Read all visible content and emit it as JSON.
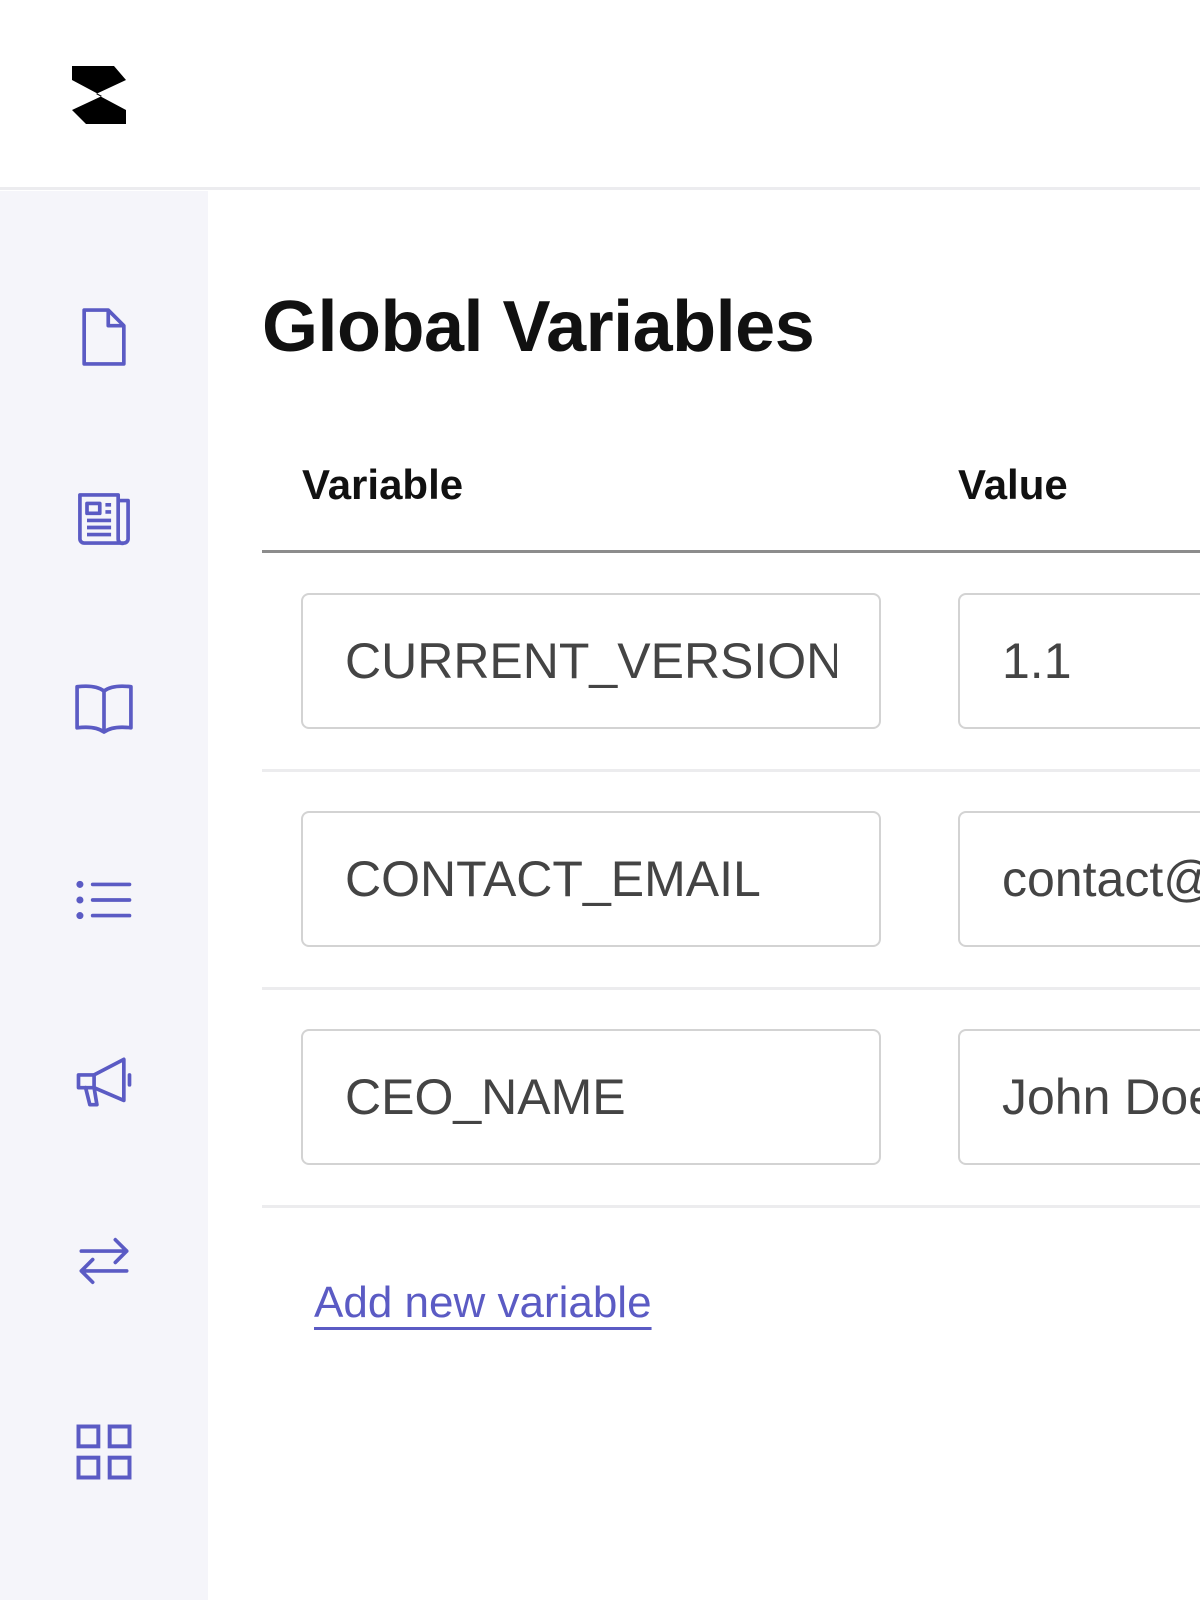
{
  "app": {
    "logo_icon": "zigzag-logo-icon"
  },
  "sidebar": {
    "accent_color": "#5b5bc4",
    "items": [
      {
        "icon": "document-icon"
      },
      {
        "icon": "newspaper-icon"
      },
      {
        "icon": "book-icon"
      },
      {
        "icon": "list-icon"
      },
      {
        "icon": "megaphone-icon"
      },
      {
        "icon": "arrows-swap-icon"
      },
      {
        "icon": "grid-icon"
      }
    ]
  },
  "main": {
    "title": "Global Variables",
    "columns": {
      "variable": "Variable",
      "value": "Value"
    },
    "rows": [
      {
        "name": "CURRENT_VERSION",
        "value": "1.1"
      },
      {
        "name": "CONTACT_EMAIL",
        "value": "contact@"
      },
      {
        "name": "CEO_NAME",
        "value": "John Doe"
      }
    ],
    "add_label": "Add new variable"
  }
}
